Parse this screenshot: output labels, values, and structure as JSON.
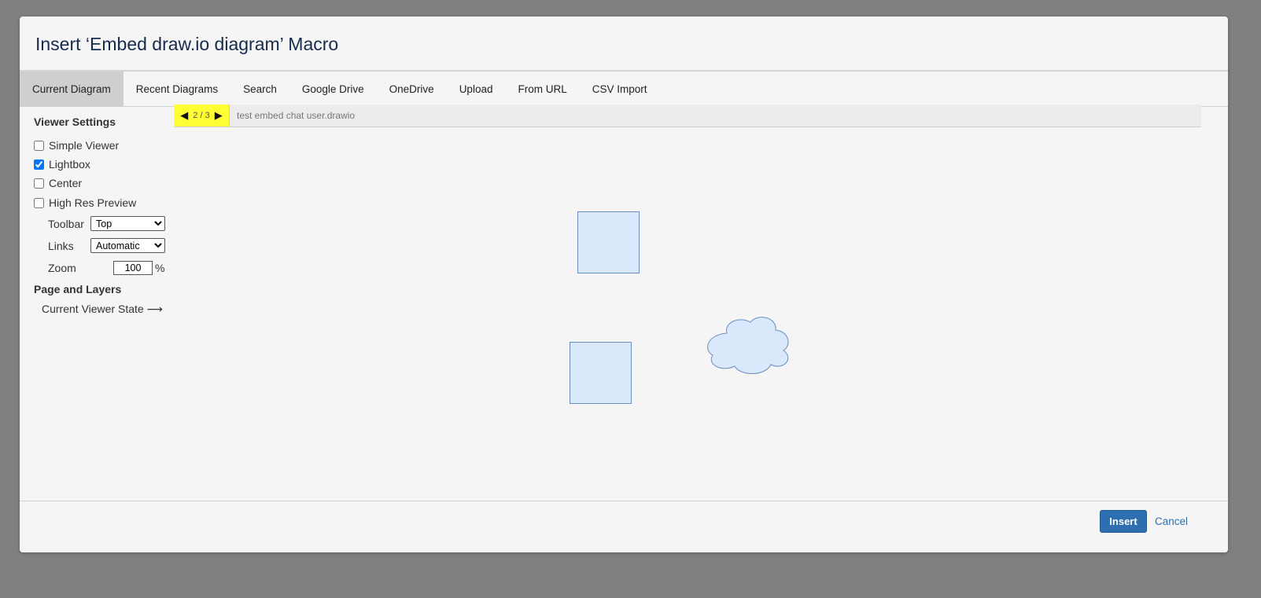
{
  "dialog": {
    "title": "Insert ‘Embed draw.io diagram’ Macro"
  },
  "tabs": [
    {
      "label": "Current Diagram",
      "active": true
    },
    {
      "label": "Recent Diagrams"
    },
    {
      "label": "Search"
    },
    {
      "label": "Google Drive"
    },
    {
      "label": "OneDrive"
    },
    {
      "label": "Upload"
    },
    {
      "label": "From URL"
    },
    {
      "label": "CSV Import"
    }
  ],
  "sidebar": {
    "viewer_settings_heading": "Viewer Settings",
    "checkboxes": [
      {
        "label": "Simple Viewer",
        "checked": false
      },
      {
        "label": "Lightbox",
        "checked": true
      },
      {
        "label": "Center",
        "checked": false
      },
      {
        "label": "High Res Preview",
        "checked": false
      }
    ],
    "toolbar": {
      "label": "Toolbar",
      "value": "Top"
    },
    "links": {
      "label": "Links",
      "value": "Automatic"
    },
    "zoom": {
      "label": "Zoom",
      "value": "100",
      "unit": "%"
    },
    "page_layers_heading": "Page and Layers",
    "viewer_state_link": "Current Viewer State ⟶"
  },
  "viewer": {
    "pager": {
      "prev_icon": "triangle-left-icon",
      "page": "2 / 3",
      "next_icon": "triangle-right-icon"
    },
    "filename": "test embed chat user.drawio",
    "shape_fill": "#dae8fc",
    "shape_stroke": "#6c8ebf",
    "highlight_color": "#ffff33"
  },
  "footer": {
    "insert_label": "Insert",
    "cancel_label": "Cancel"
  },
  "colors": {
    "backdrop": "#808080",
    "primary": "#2d6fb0",
    "dialog_bg": "#f5f5f5"
  }
}
